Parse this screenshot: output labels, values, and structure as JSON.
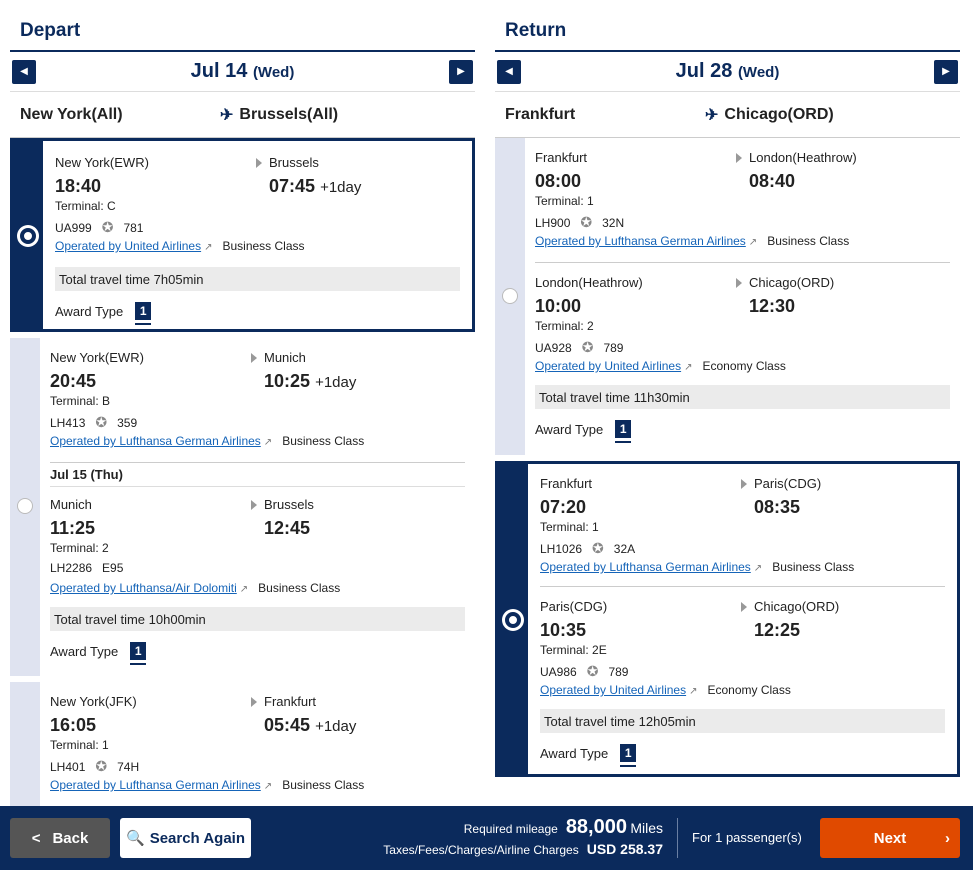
{
  "depart": {
    "title": "Depart",
    "date": "Jul 14",
    "dow": "(Wed)",
    "origin": "New York(All)",
    "destination": "Brussels(All)",
    "options": [
      {
        "segments": [
          {
            "from": "New York(EWR)",
            "to": "Brussels",
            "dep": "18:40",
            "arr": "07:45",
            "plus": "+1day",
            "terminal": "Terminal: C",
            "flight": "UA999",
            "aircraft": "781",
            "operator": "Operated by United Airlines",
            "cabin": "Business Class"
          }
        ],
        "total": "Total travel time 7h05min",
        "award_label": "Award Type",
        "award": "1"
      },
      {
        "segments": [
          {
            "from": "New York(EWR)",
            "to": "Munich",
            "dep": "20:45",
            "arr": "10:25",
            "plus": "+1day",
            "terminal": "Terminal: B",
            "flight": "LH413",
            "aircraft": "359",
            "operator": "Operated by Lufthansa German Airlines",
            "cabin": "Business Class"
          },
          {
            "subdate": "Jul 15 (Thu)",
            "from": "Munich",
            "to": "Brussels",
            "dep": "11:25",
            "arr": "12:45",
            "plus": "",
            "terminal": "Terminal: 2",
            "flight": "LH2286",
            "aircraft": "E95",
            "operator": "Operated by Lufthansa/Air Dolomiti",
            "cabin": "Business Class"
          }
        ],
        "total": "Total travel time 10h00min",
        "award_label": "Award Type",
        "award": "1"
      },
      {
        "segments": [
          {
            "from": "New York(JFK)",
            "to": "Frankfurt",
            "dep": "16:05",
            "arr": "05:45",
            "plus": "+1day",
            "terminal": "Terminal: 1",
            "flight": "LH401",
            "aircraft": "74H",
            "operator": "Operated by Lufthansa German Airlines",
            "cabin": "Business Class"
          }
        ]
      }
    ]
  },
  "return": {
    "title": "Return",
    "date": "Jul 28",
    "dow": "(Wed)",
    "origin": "Frankfurt",
    "destination": "Chicago(ORD)",
    "options": [
      {
        "segments": [
          {
            "from": "Frankfurt",
            "to": "London(Heathrow)",
            "dep": "08:00",
            "arr": "08:40",
            "plus": "",
            "terminal": "Terminal: 1",
            "flight": "LH900",
            "aircraft": "32N",
            "operator": "Operated by Lufthansa German Airlines",
            "cabin": "Business Class"
          },
          {
            "from": "London(Heathrow)",
            "to": "Chicago(ORD)",
            "dep": "10:00",
            "arr": "12:30",
            "plus": "",
            "terminal": "Terminal: 2",
            "flight": "UA928",
            "aircraft": "789",
            "operator": "Operated by United Airlines",
            "cabin": "Economy Class"
          }
        ],
        "total": "Total travel time 11h30min",
        "award_label": "Award Type",
        "award": "1"
      },
      {
        "segments": [
          {
            "from": "Frankfurt",
            "to": "Paris(CDG)",
            "dep": "07:20",
            "arr": "08:35",
            "plus": "",
            "terminal": "Terminal: 1",
            "flight": "LH1026",
            "aircraft": "32A",
            "operator": "Operated by Lufthansa German Airlines",
            "cabin": "Business Class"
          },
          {
            "from": "Paris(CDG)",
            "to": "Chicago(ORD)",
            "dep": "10:35",
            "arr": "12:25",
            "plus": "",
            "terminal": "Terminal: 2E",
            "flight": "UA986",
            "aircraft": "789",
            "operator": "Operated by United Airlines",
            "cabin": "Economy Class"
          }
        ],
        "total": "Total travel time 12h05min",
        "award_label": "Award Type",
        "award": "1"
      }
    ]
  },
  "footer": {
    "back": "Back",
    "search_again": "Search Again",
    "required_mileage_label": "Required mileage",
    "mileage": "88,000",
    "mileage_unit": "Miles",
    "taxes_label": "Taxes/Fees/Charges/Airline Charges",
    "taxes_amount": "USD  258.37",
    "passengers": "For 1 passenger(s)",
    "next": "Next"
  },
  "colors": {
    "navy": "#0b2a5c",
    "next": "#e04a00",
    "link": "#1564b8"
  }
}
